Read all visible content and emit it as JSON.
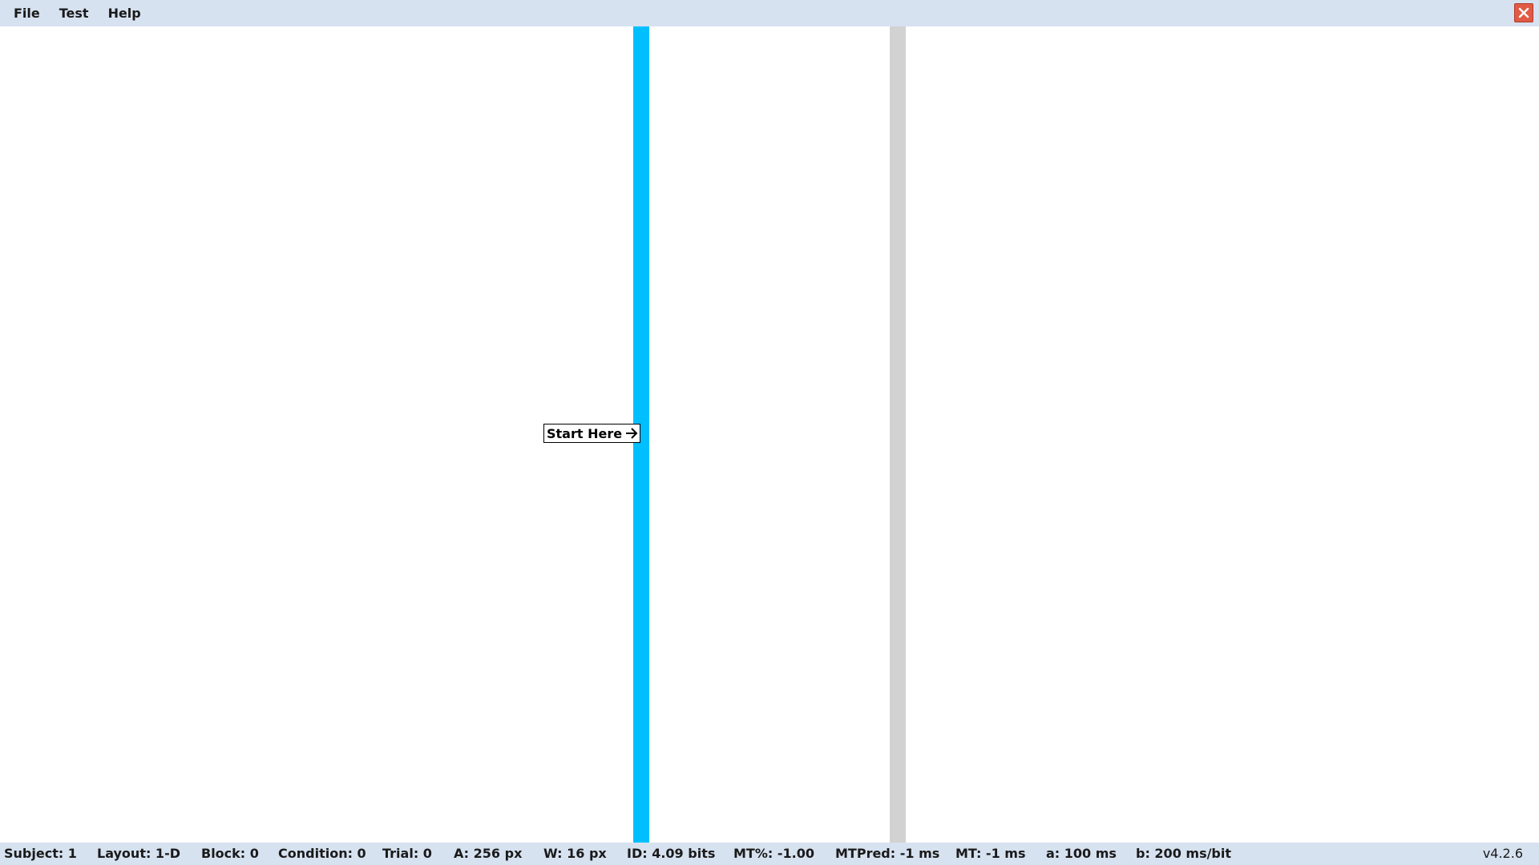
{
  "menu": {
    "items": [
      {
        "label": "File"
      },
      {
        "label": "Test"
      },
      {
        "label": "Help"
      }
    ]
  },
  "window": {
    "close_icon": "close-icon",
    "close_color": "#e05a45"
  },
  "canvas": {
    "start_label": "Start Here",
    "start_icon": "arrow-right-icon",
    "active_target_color": "#00bfff",
    "inactive_target_color": "#d2d2d2"
  },
  "status": {
    "subject": "Subject: 1",
    "layout": "Layout: 1-D",
    "block": "Block: 0",
    "condition": "Condition: 0",
    "trial": "Trial: 0",
    "amplitude": "A: 256 px",
    "width": "W: 16 px",
    "id": "ID: 4.09 bits",
    "mt_percent": "MT%: -1.00",
    "mt_pred": "MTPred: -1 ms",
    "mt": "MT: -1 ms",
    "a": "a: 100 ms",
    "b": "b: 200 ms/bit",
    "version": "v4.2.6"
  }
}
